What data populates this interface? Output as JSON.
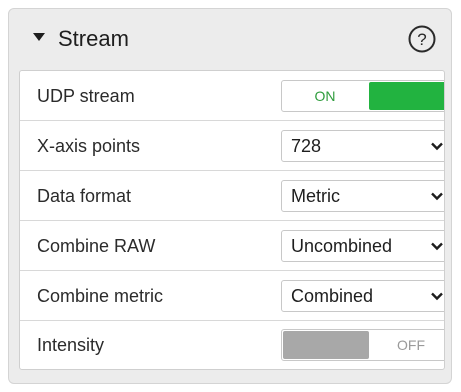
{
  "panel": {
    "title": "Stream",
    "collapse_icon": "triangle-down",
    "help_icon": "question-circle"
  },
  "rows": {
    "udp_stream": {
      "label": "UDP stream",
      "state_label": "ON",
      "state": "on"
    },
    "x_axis_points": {
      "label": "X-axis points",
      "value": "728"
    },
    "data_format": {
      "label": "Data format",
      "value": "Metric"
    },
    "combine_raw": {
      "label": "Combine RAW",
      "value": "Uncombined"
    },
    "combine_metric": {
      "label": "Combine metric",
      "value": "Combined"
    },
    "intensity": {
      "label": "Intensity",
      "state_label": "OFF",
      "state": "off"
    }
  },
  "colors": {
    "toggle_on": "#22b340",
    "toggle_off": "#a8a8a8",
    "panel_bg": "#ececec"
  }
}
